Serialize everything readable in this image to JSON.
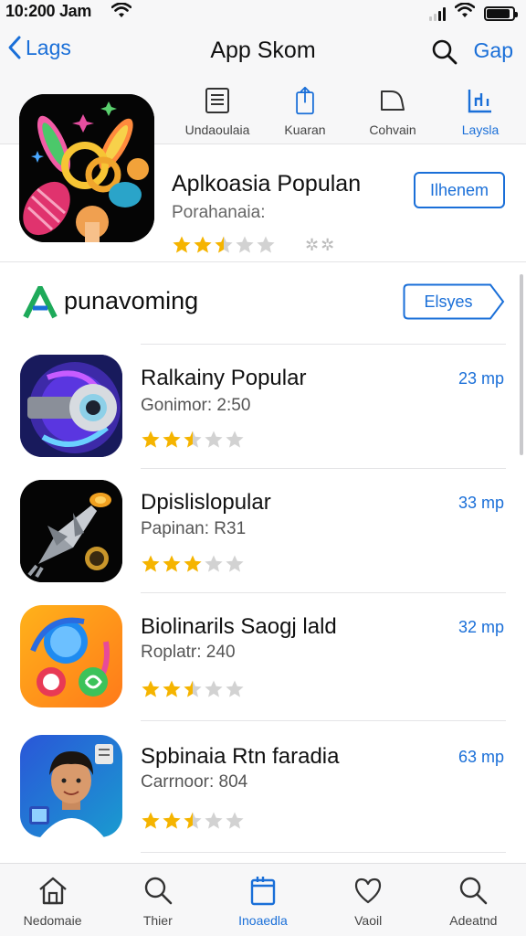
{
  "status_bar": {
    "time": "10:200 Jam",
    "battery_level": 0.9
  },
  "nav": {
    "back_label": "Lags",
    "title": "App Skom",
    "action_label": "Gap"
  },
  "category_tabs": [
    {
      "label": "Undaoulaia",
      "icon": "document-icon",
      "active": false
    },
    {
      "label": "Kuaran",
      "icon": "share-icon",
      "active": false
    },
    {
      "label": "Cohvain",
      "icon": "folder-icon",
      "active": false
    },
    {
      "label": "Laysla",
      "icon": "chart-icon",
      "active": true
    }
  ],
  "featured": {
    "title": "Aplkoasia Populan",
    "subtitle": "Porahanaia:",
    "rating": 2.5,
    "button_label": "Ilhenem"
  },
  "section": {
    "title": "punavoming",
    "button_label": "Elsyes"
  },
  "apps": [
    {
      "name": "Ralkainy Popular",
      "meta": "Gonimor:  2:50",
      "size": "23 mp",
      "rating": 2.5
    },
    {
      "name": "Dpislislopular",
      "meta": "Papinan:  R31",
      "size": "33 mp",
      "rating": 3
    },
    {
      "name": "Biolinarils Saogj lald",
      "meta": "Roplatr:  240",
      "size": "32 mp",
      "rating": 2.5
    },
    {
      "name": "Spbinaia Rtn faradia",
      "meta": "Carrnoor:  804",
      "size": "63 mp",
      "rating": 2.5
    }
  ],
  "tab_bar": [
    {
      "label": "Nedomaie",
      "icon": "home-icon",
      "active": false
    },
    {
      "label": "Thier",
      "icon": "search-icon",
      "active": false
    },
    {
      "label": "Inoaedla",
      "icon": "apps-icon",
      "active": true
    },
    {
      "label": "Vaoil",
      "icon": "heart-icon",
      "active": false
    },
    {
      "label": "Adeatnd",
      "icon": "search-icon",
      "active": false
    }
  ],
  "colors": {
    "accent": "#1a6fd8",
    "star": "#f5b400",
    "star_empty": "#d2d2d2"
  }
}
